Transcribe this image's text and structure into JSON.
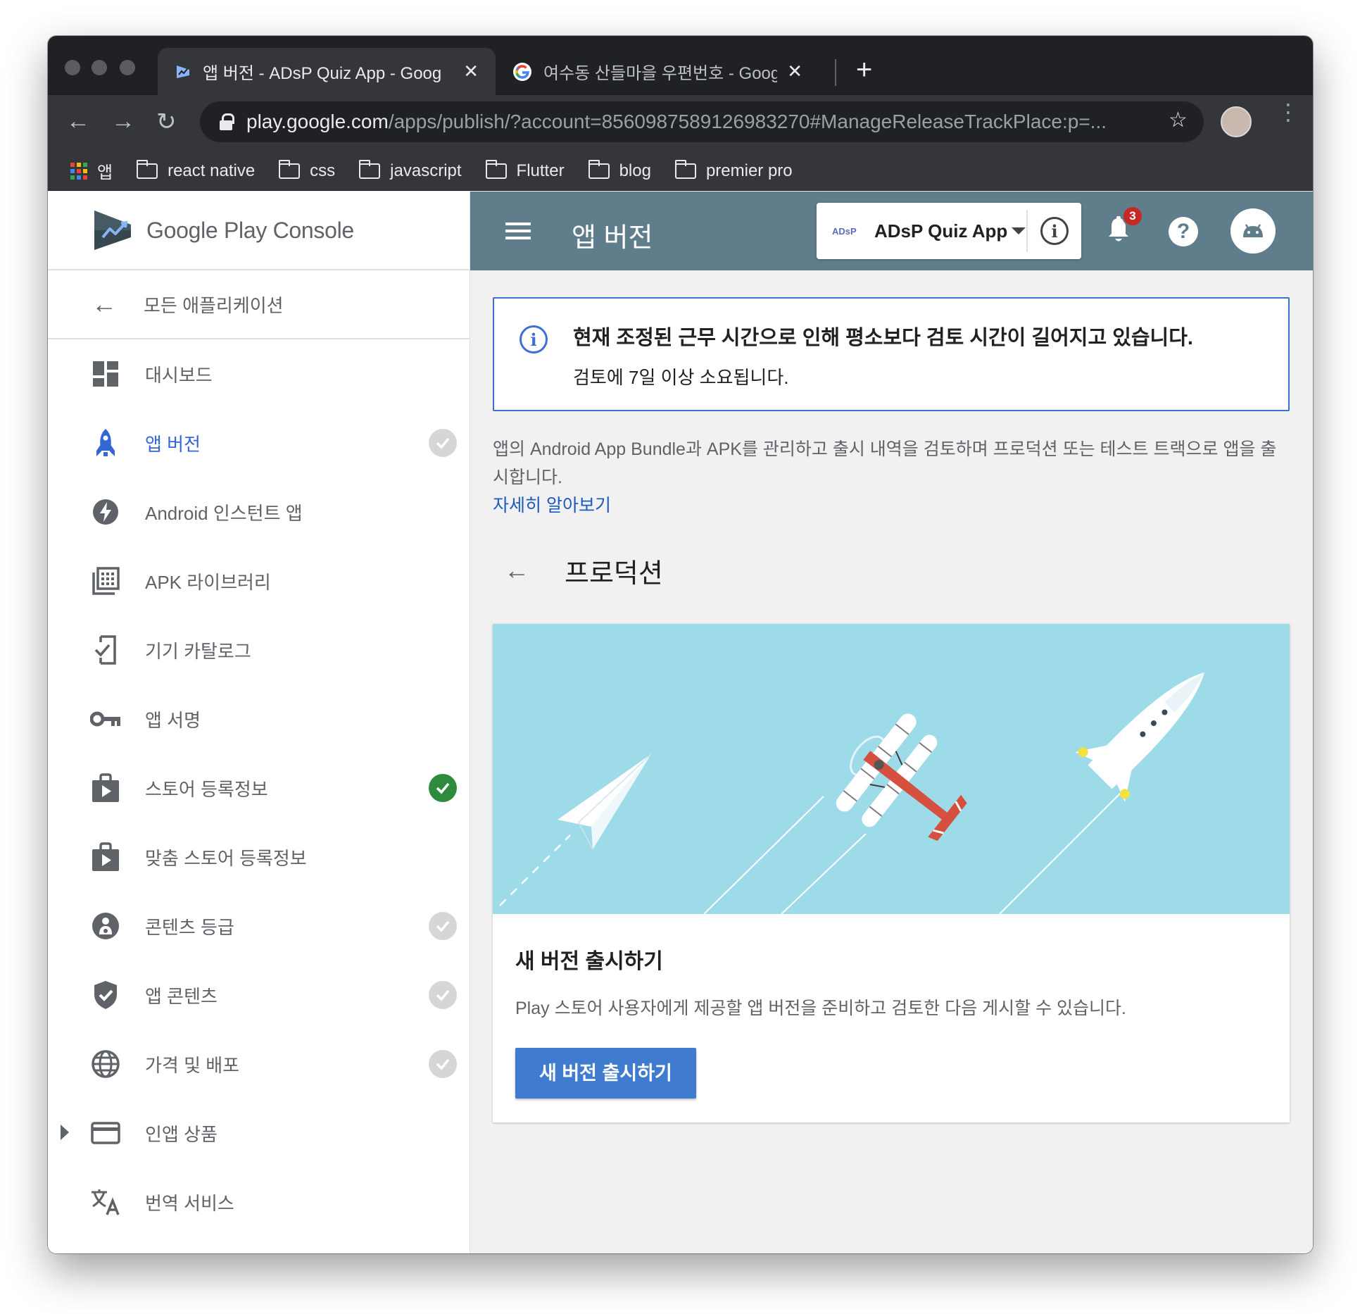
{
  "browser": {
    "tabs": [
      {
        "title": "앱 버전 - ADsP Quiz App - Goog",
        "active": true
      },
      {
        "title": "여수동 산들마을 우편번호 - Google",
        "active": false
      }
    ],
    "close_glyph": "✕",
    "new_tab_glyph": "+",
    "nav": {
      "back": "←",
      "forward": "→",
      "reload": "↻"
    },
    "url_host": "play.google.com",
    "url_path": "/apps/publish/?account=8560987589126983270#ManageReleaseTrackPlace:p=...",
    "star_glyph": "☆",
    "menu_glyph": "⋮",
    "bookmarks": {
      "apps_label": "앱",
      "folders": [
        "react native",
        "css",
        "javascript",
        "Flutter",
        "blog",
        "premier pro"
      ]
    }
  },
  "console": {
    "brand": "Google Play Console",
    "back_label": "모든 애플리케이션",
    "back_glyph": "←",
    "nav_items": [
      {
        "label": "대시보드",
        "icon": "dashboard-icon",
        "status": "none"
      },
      {
        "label": "앱 버전",
        "icon": "rocket-icon",
        "status": "incomplete",
        "active": true
      },
      {
        "label": "Android 인스턴트 앱",
        "icon": "bolt-icon",
        "status": "none"
      },
      {
        "label": "APK 라이브러리",
        "icon": "library-icon",
        "status": "none"
      },
      {
        "label": "기기 카탈로그",
        "icon": "device-catalog-icon",
        "status": "none"
      },
      {
        "label": "앱 서명",
        "icon": "key-icon",
        "status": "none"
      },
      {
        "label": "스토어 등록정보",
        "icon": "store-listing-icon",
        "status": "complete"
      },
      {
        "label": "맞춤 스토어 등록정보",
        "icon": "store-listing-icon",
        "status": "none"
      },
      {
        "label": "콘텐츠 등급",
        "icon": "content-rating-icon",
        "status": "incomplete"
      },
      {
        "label": "앱 콘텐츠",
        "icon": "shield-icon",
        "status": "incomplete"
      },
      {
        "label": "가격 및 배포",
        "icon": "globe-icon",
        "status": "incomplete"
      },
      {
        "label": "인앱 상품",
        "icon": "credit-card-icon",
        "status": "none",
        "expandable": true
      },
      {
        "label": "번역 서비스",
        "icon": "translate-icon",
        "status": "none"
      }
    ],
    "topbar": {
      "title": "앱 버전",
      "app_logo_text": "ADsP",
      "app_name": "ADsP Quiz App",
      "info_glyph": "i",
      "notification_count": "3",
      "help_glyph": "?"
    },
    "notice": {
      "info_glyph": "i",
      "title": "현재 조정된 근무 시간으로 인해 평소보다 검토 시간이 길어지고 있습니다.",
      "body": "검토에 7일 이상 소요됩니다."
    },
    "description": "앱의 Android App Bundle과 APK를 관리하고 출시 내역을 검토하며 프로덕션 또는 테스트 트랙으로 앱을 출시합니다.",
    "learn_more": "자세히 알아보기",
    "section": {
      "back_glyph": "←",
      "title": "프로덕션"
    },
    "card": {
      "title": "새 버전 출시하기",
      "body": "Play 스토어 사용자에게 제공할 앱 버전을 준비하고 검토한 다음 게시할 수 있습니다.",
      "button": "새 버전 출시하기"
    },
    "colors": {
      "topbar": "#607d8b",
      "accent": "#3367d6",
      "complete": "#2e8b3d",
      "incomplete": "#d6d6d6",
      "illustration_sky": "#9ddbe8",
      "cta": "#3f7bce"
    }
  }
}
